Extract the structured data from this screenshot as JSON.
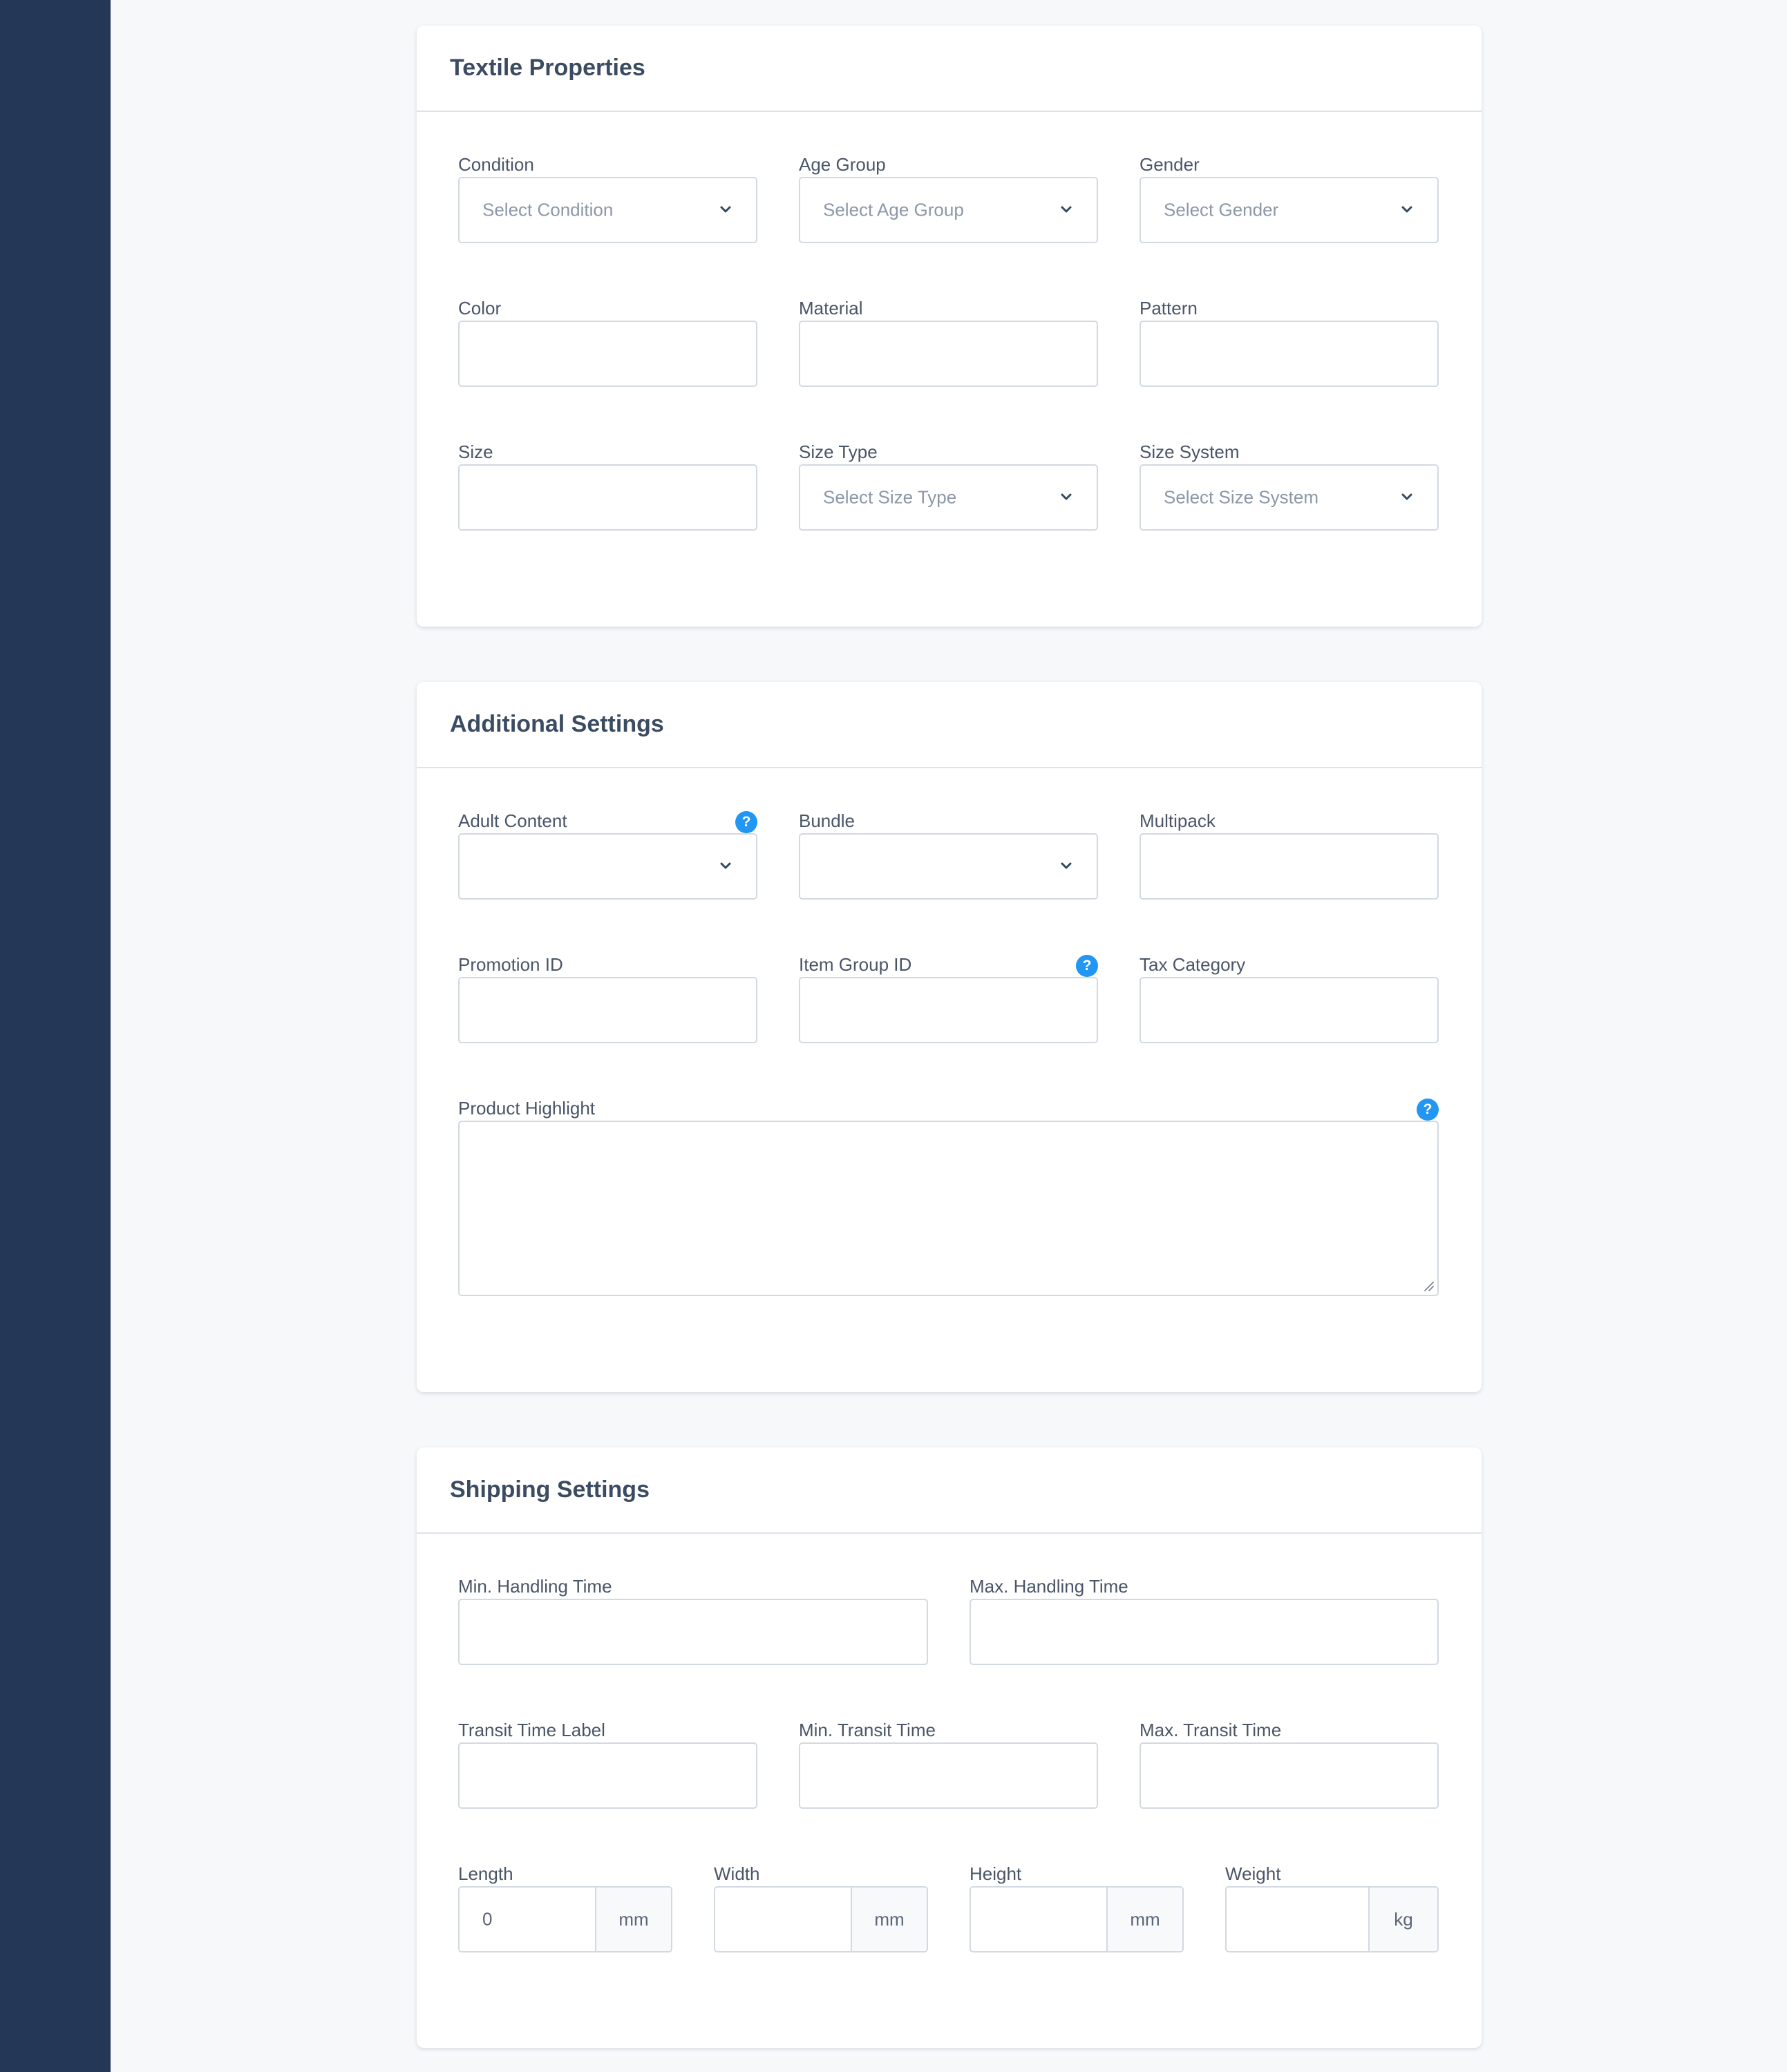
{
  "textile": {
    "title": "Textile Properties",
    "condition": {
      "label": "Condition",
      "placeholder": "Select Condition"
    },
    "age_group": {
      "label": "Age Group",
      "placeholder": "Select Age Group"
    },
    "gender": {
      "label": "Gender",
      "placeholder": "Select Gender"
    },
    "color": {
      "label": "Color",
      "value": ""
    },
    "material": {
      "label": "Material",
      "value": ""
    },
    "pattern": {
      "label": "Pattern",
      "value": ""
    },
    "size": {
      "label": "Size",
      "value": ""
    },
    "size_type": {
      "label": "Size Type",
      "placeholder": "Select Size Type"
    },
    "size_system": {
      "label": "Size System",
      "placeholder": "Select Size System"
    }
  },
  "additional": {
    "title": "Additional Settings",
    "adult_content": {
      "label": "Adult Content",
      "value": "",
      "help": "?"
    },
    "bundle": {
      "label": "Bundle",
      "value": ""
    },
    "multipack": {
      "label": "Multipack",
      "value": ""
    },
    "promotion_id": {
      "label": "Promotion ID",
      "value": ""
    },
    "item_group_id": {
      "label": "Item Group ID",
      "value": "",
      "help": "?"
    },
    "tax_category": {
      "label": "Tax Category",
      "value": ""
    },
    "product_highlight": {
      "label": "Product Highlight",
      "value": "",
      "help": "?"
    }
  },
  "shipping": {
    "title": "Shipping Settings",
    "min_handling": {
      "label": "Min. Handling Time",
      "value": ""
    },
    "max_handling": {
      "label": "Max. Handling Time",
      "value": ""
    },
    "transit_label": {
      "label": "Transit Time Label",
      "value": ""
    },
    "min_transit": {
      "label": "Min. Transit Time",
      "value": ""
    },
    "max_transit": {
      "label": "Max. Transit Time",
      "value": ""
    },
    "length": {
      "label": "Length",
      "value": "0",
      "unit": "mm"
    },
    "width": {
      "label": "Width",
      "value": "",
      "unit": "mm"
    },
    "height": {
      "label": "Height",
      "value": "",
      "unit": "mm"
    },
    "weight": {
      "label": "Weight",
      "value": "",
      "unit": "kg"
    }
  },
  "icons": {
    "chevron": "chevron-down-icon",
    "help": "question-circle-icon",
    "resize": "resize-handle-icon"
  },
  "colors": {
    "sidebar": "#253757",
    "page_bg": "#f6f8fa",
    "help_accent": "#2196f3"
  }
}
